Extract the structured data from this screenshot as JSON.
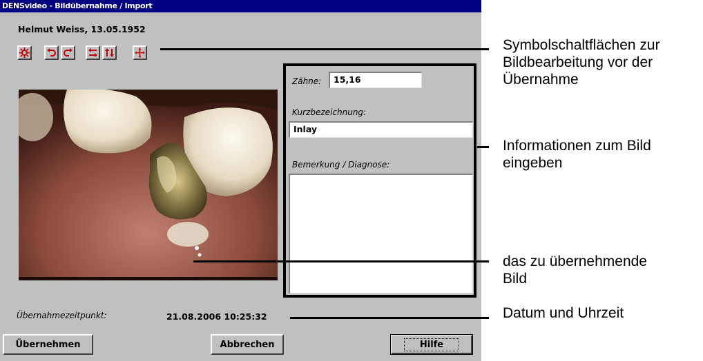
{
  "window": {
    "title": "DENSvideo - Bildübernahme / Import",
    "patient": "Helmut Weiss, 13.05.1952"
  },
  "toolbar": {
    "buttons": [
      {
        "icon": "brightness-icon"
      },
      {
        "icon": "rotate-left-icon"
      },
      {
        "icon": "rotate-right-icon"
      },
      {
        "icon": "flip-horizontal-icon"
      },
      {
        "icon": "flip-vertical-icon"
      },
      {
        "icon": "move-icon"
      }
    ],
    "icon_color": "#c00000"
  },
  "form": {
    "teeth_label": "Zähne:",
    "teeth_value": "15,16",
    "short_label": "Kurzbezeichnung:",
    "short_value": "Inlay",
    "remark_label": "Bemerkung / Diagnose:",
    "remark_value": ""
  },
  "timestamp": {
    "label": "Übernahmezeitpunkt:",
    "value": "21.08.2006  10:25:32"
  },
  "buttons": {
    "accept": "Übernehmen",
    "cancel": "Abbrechen",
    "help": "Hilfe"
  },
  "callouts": {
    "toolbar": "Symbolschaltflächen zur\nBildbearbeitung vor der\nÜbernahme",
    "info": "Informationen zum Bild\neingeben",
    "image": "das zu übernehmende\nBild",
    "datetime": "Datum und Uhrzeit"
  }
}
